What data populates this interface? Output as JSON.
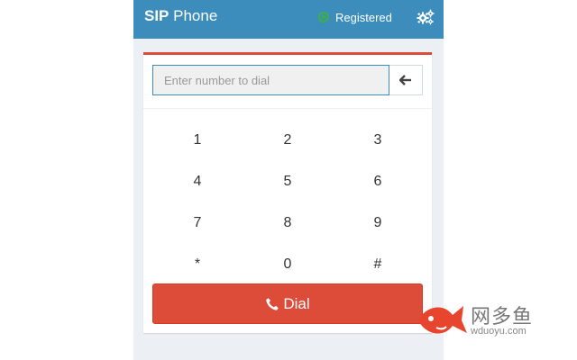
{
  "header": {
    "brand_bold": "SIP",
    "brand_rest": "Phone",
    "status_text": "Registered",
    "status_color": "#3cb043",
    "settings_icon": "gears-icon"
  },
  "dialer": {
    "input_value": "",
    "input_placeholder": "Enter number to dial",
    "backspace_icon": "arrow-left-icon",
    "keys": [
      "1",
      "2",
      "3",
      "4",
      "5",
      "6",
      "7",
      "8",
      "9",
      "*",
      "0",
      "#"
    ],
    "dial_label": "Dial",
    "dial_icon": "phone-icon"
  },
  "watermark": {
    "title": "网多鱼",
    "url": "wduoyu.com"
  },
  "colors": {
    "header_bg": "#3c8dbc",
    "accent_red": "#dd4b39",
    "app_bg": "#ecf0f5"
  }
}
